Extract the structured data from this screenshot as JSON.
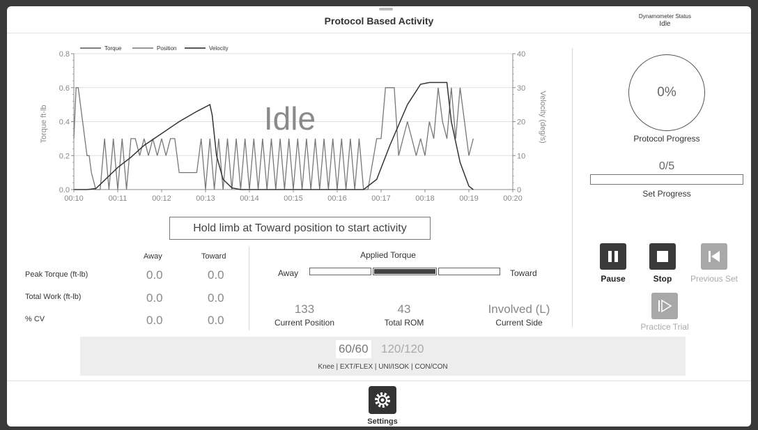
{
  "header": {
    "title": "Protocol Based Activity",
    "dyn_status_label": "Dynamometer Status",
    "dyn_status_value": "Idle"
  },
  "chart_data": {
    "type": "line",
    "legend": [
      "Torque",
      "Position",
      "Velocity"
    ],
    "legend_placement": "top-left",
    "overlay_text": "Idle",
    "ylabel": "Torque ft-lb",
    "y2label": "Velocity (deg/s)",
    "ylim": [
      0,
      0.8
    ],
    "y2lim": [
      0,
      40
    ],
    "yticks": [
      "0.0",
      "0.2",
      "0.4",
      "0.6",
      "0.8"
    ],
    "y2ticks": [
      "0",
      "10",
      "20",
      "30",
      "40"
    ],
    "xticks": [
      "00:10",
      "00:11",
      "00:12",
      "00:13",
      "00:14",
      "00:15",
      "00:16",
      "00:17",
      "00:18",
      "00:19",
      "00:20"
    ],
    "series": [
      {
        "name": "Velocity",
        "color": "#333333",
        "x": [
          10.0,
          10.3,
          10.5,
          10.6,
          10.8,
          11.0,
          11.3,
          11.6,
          12.0,
          12.4,
          12.8,
          13.1,
          13.15,
          13.25,
          13.4,
          13.6,
          13.8,
          14.5,
          16.6,
          16.9,
          17.2,
          17.6,
          17.9,
          18.1,
          18.3,
          18.5,
          18.6,
          18.8,
          19.0,
          19.1
        ],
        "y": [
          0,
          0,
          0.3,
          1.5,
          4,
          6.5,
          9.5,
          13,
          16.5,
          20,
          23,
          25,
          22,
          10,
          3,
          0.5,
          0,
          0,
          0,
          3,
          13,
          25,
          31,
          31.5,
          31.5,
          31.5,
          20,
          8,
          1,
          0
        ]
      },
      {
        "name": "Position",
        "color": "#777777",
        "x": [
          10.0,
          10.05,
          10.1,
          10.2,
          10.3,
          10.35,
          10.4,
          10.5,
          10.6,
          10.7,
          10.8,
          10.9,
          11.0,
          11.1,
          11.2,
          11.3,
          11.4,
          11.5,
          11.6,
          11.7,
          11.8,
          11.9,
          12.0,
          12.1,
          12.2,
          12.3,
          12.4,
          12.5,
          12.6,
          12.7,
          12.8,
          12.9,
          13.0,
          13.1,
          13.2,
          13.3,
          13.4,
          13.5,
          13.6,
          13.7,
          13.8,
          13.9,
          14.0,
          14.1,
          14.2,
          14.3,
          14.4,
          14.5,
          14.6,
          14.7,
          14.8,
          14.9,
          15.0,
          15.1,
          15.2,
          15.3,
          15.4,
          15.5,
          15.6,
          15.7,
          15.8,
          15.9,
          16.0,
          16.1,
          16.2,
          16.3,
          16.4,
          16.5,
          16.6,
          16.7,
          16.9,
          17.0,
          17.1,
          17.2,
          17.3,
          17.4,
          17.5,
          17.6,
          17.7,
          17.8,
          17.9,
          18.0,
          18.1,
          18.2,
          18.3,
          18.4,
          18.5,
          18.6,
          18.7,
          18.8,
          18.9,
          19.0,
          19.1
        ],
        "y": [
          0.3,
          0.6,
          0.6,
          0.4,
          0.2,
          0.2,
          0.1,
          0,
          0,
          0.3,
          0,
          0.3,
          0,
          0.3,
          0,
          0.3,
          0.3,
          0.2,
          0.3,
          0.2,
          0.3,
          0.2,
          0.3,
          0.2,
          0.3,
          0.3,
          0.1,
          0.1,
          0.1,
          0.1,
          0.1,
          0.3,
          0,
          0.3,
          0,
          0.3,
          0,
          0.3,
          0,
          0.3,
          0,
          0.3,
          0,
          0.3,
          0,
          0.3,
          0,
          0.3,
          0,
          0.3,
          0,
          0.3,
          0,
          0.3,
          0,
          0.3,
          0,
          0.3,
          0,
          0.3,
          0,
          0.3,
          0,
          0.3,
          0,
          0.3,
          0,
          0.3,
          0,
          0,
          0.3,
          0.3,
          0.6,
          0.6,
          0.6,
          0.2,
          0.3,
          0.4,
          0.3,
          0.2,
          0.3,
          0.2,
          0.4,
          0.3,
          0.6,
          0.4,
          0.3,
          0.6,
          0.3,
          0.6,
          0.4,
          0.2,
          0.3
        ]
      }
    ]
  },
  "hint": "Hold limb at Toward position to start activity",
  "stats": {
    "col_away": "Away",
    "col_toward": "Toward",
    "rows": [
      {
        "label": "Peak Torque (ft-lb)",
        "away": "0.0",
        "toward": "0.0"
      },
      {
        "label": "Total Work (ft-lb)",
        "away": "0.0",
        "toward": "0.0"
      },
      {
        "label": "% CV",
        "away": "0.0",
        "toward": "0.0"
      }
    ]
  },
  "applied": {
    "title": "Applied Torque",
    "away": "Away",
    "toward": "Toward",
    "current_position_value": "133",
    "current_position_label": "Current Position",
    "total_rom_value": "43",
    "total_rom_label": "Total ROM",
    "side_value": "Involved (L)",
    "side_label": "Current Side"
  },
  "progress": {
    "percent": "0%",
    "protocol_label": "Protocol Progress",
    "set_count": "0/5",
    "set_label": "Set Progress",
    "set_fraction": 0
  },
  "controls": {
    "pause": "Pause",
    "stop": "Stop",
    "previous_set": "Previous Set",
    "practice_trial": "Practice Trial"
  },
  "speeds": {
    "active": "60/60",
    "other": "120/120",
    "description": "Knee | EXT/FLEX | UNI/ISOK | CON/CON"
  },
  "footer": {
    "settings": "Settings"
  }
}
